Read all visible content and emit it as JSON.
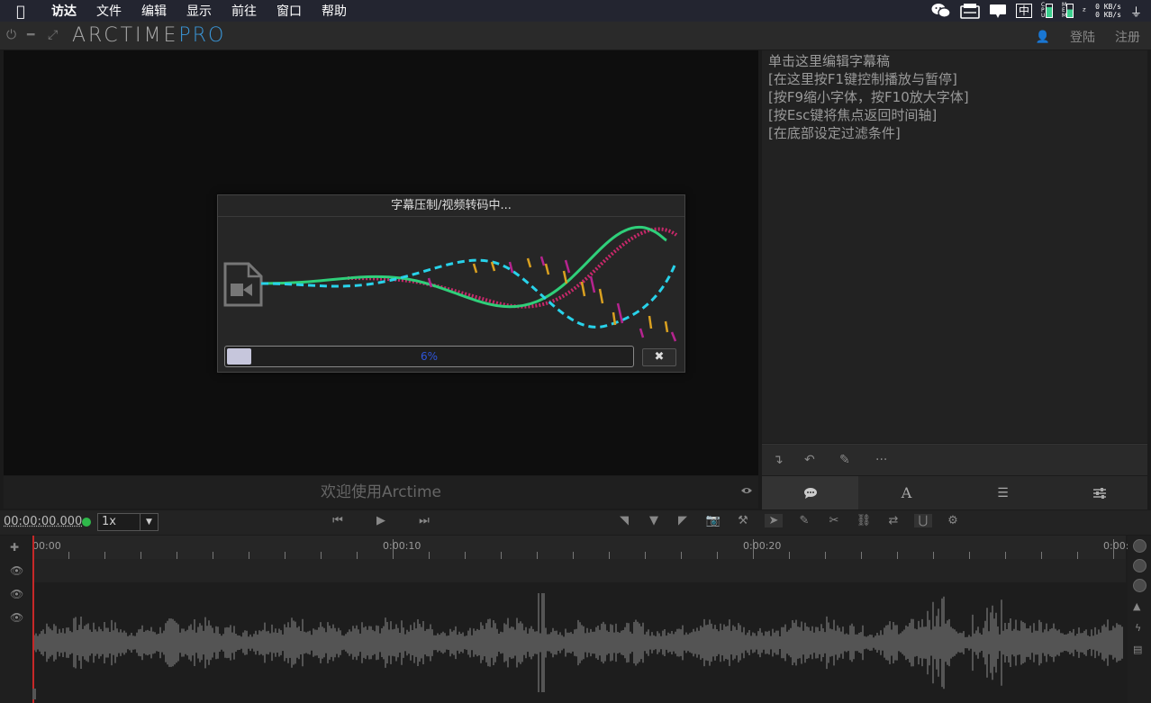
{
  "menubar": {
    "apple_icon": "apple-icon",
    "items": [
      "访达",
      "文件",
      "编辑",
      "显示",
      "前往",
      "窗口",
      "帮助"
    ],
    "tray": {
      "input_method": "中",
      "cpu_label": "CPU",
      "mem_label": "MEM",
      "net_up": "0 KB/s",
      "net_down": "0 KB/s"
    }
  },
  "app": {
    "brand_main": "ARCTIME",
    "brand_pro": "PRO",
    "login": "登陆",
    "register": "注册"
  },
  "video": {
    "caption": "欢迎使用Arctime"
  },
  "dialog": {
    "title": "字幕压制/视频转码中...",
    "progress": 0.06,
    "progress_text": "6%",
    "cancel_label": "✖"
  },
  "editor": {
    "lines": [
      "单击这里编辑字幕稿",
      "[在这里按F1键控制播放与暂停]",
      "[按F9缩小字体，按F10放大字体]",
      "[按Esc键将焦点返回时间轴]",
      "[在底部设定过滤条件]"
    ],
    "tabs": [
      "speech-bubble-icon",
      "A",
      "list-icon",
      "sliders-icon"
    ]
  },
  "transport": {
    "timecode": "00:00:00.000",
    "speed": "1x"
  },
  "timeline": {
    "ruler_labels": [
      "00:00",
      "0:00:10",
      "0:00:20",
      "0:00:"
    ]
  },
  "colors": {
    "accent": "#3a96d8",
    "status_ok": "#2fb84a",
    "playhead": "#c62828",
    "progress_text": "#2f55d9"
  }
}
